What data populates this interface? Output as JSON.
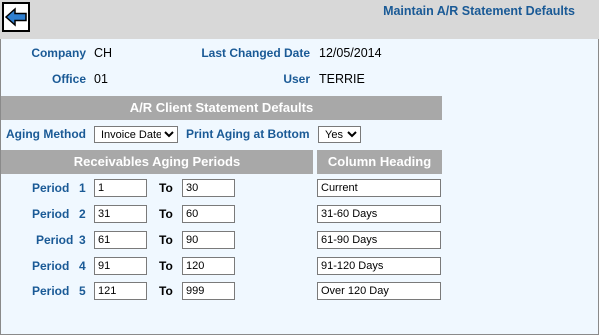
{
  "header": {
    "title": "Maintain A/R Statement Defaults",
    "back_icon": "back-arrow-icon"
  },
  "info": {
    "company_label": "Company",
    "company_value": "CH",
    "office_label": "Office",
    "office_value": "01",
    "last_changed_label": "Last Changed Date",
    "last_changed_value": "12/05/2014",
    "user_label": "User",
    "user_value": "TERRIE"
  },
  "client_defaults": {
    "section_title": "A/R Client Statement Defaults",
    "aging_method_label": "Aging Method",
    "aging_method_value": "Invoice Date",
    "print_aging_label": "Print Aging at Bottom",
    "print_aging_value": "Yes"
  },
  "aging": {
    "periods_title": "Receivables Aging Periods",
    "heading_title": "Column Heading",
    "period_label": "Period",
    "to_label": "To",
    "rows": [
      {
        "num": "1",
        "from": "1",
        "to": "30",
        "heading": "Current"
      },
      {
        "num": "2",
        "from": "31",
        "to": "60",
        "heading": "31-60 Days"
      },
      {
        "num": "3",
        "from": "61",
        "to": "90",
        "heading": "61-90 Days"
      },
      {
        "num": "4",
        "from": "91",
        "to": "120",
        "heading": "91-120 Days"
      },
      {
        "num": "5",
        "from": "121",
        "to": "999",
        "heading": "Over 120 Day"
      }
    ]
  },
  "colors": {
    "label_blue": "#1a5a96",
    "bar_gray": "#a8a8a8",
    "page_bg": "#f0f8ff"
  }
}
